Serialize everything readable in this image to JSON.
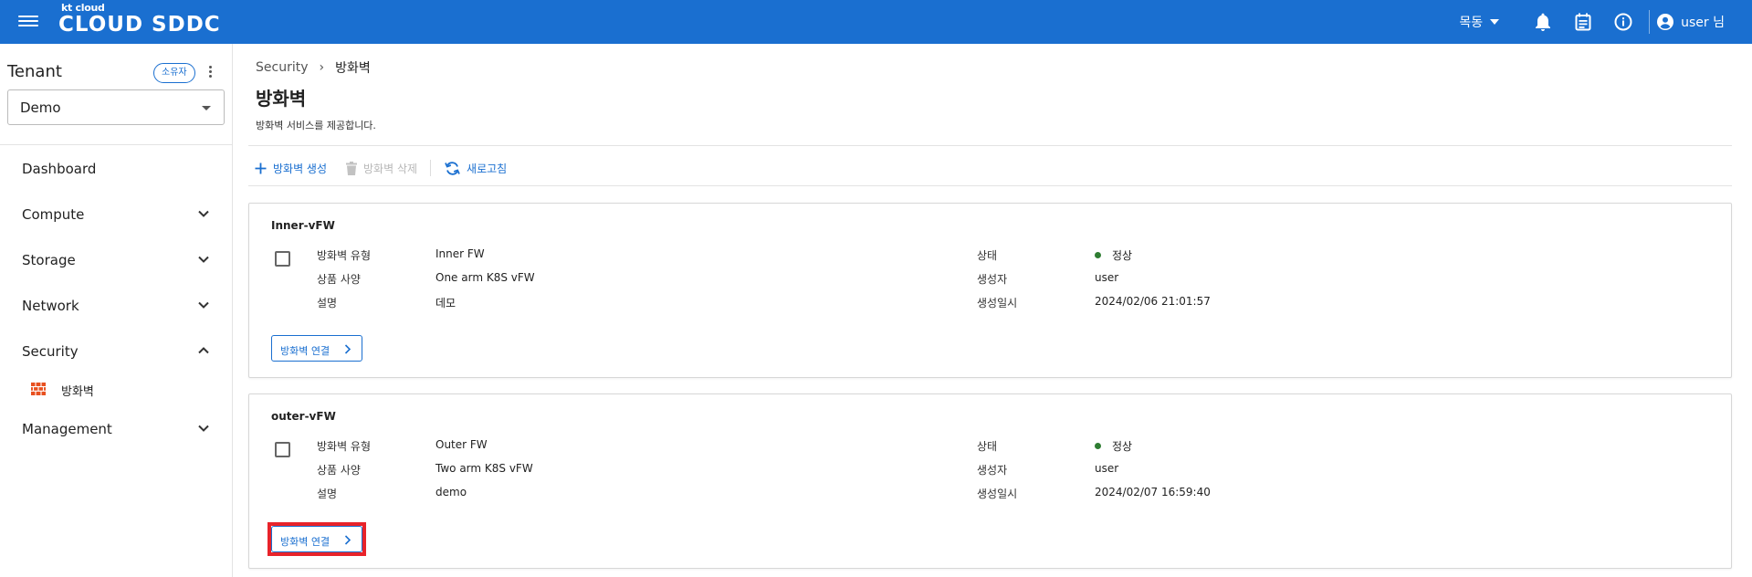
{
  "header": {
    "logo_small": "kt cloud",
    "logo_brand": "CLOUD SDDC",
    "region": "목동",
    "user": "user 님",
    "colors": {
      "bar": "#1a6fd0",
      "text": "#ffffff"
    }
  },
  "sidebar": {
    "tenant_label": "Tenant",
    "owner_badge": "소유자",
    "tenant_value": "Demo",
    "items": [
      {
        "label": "Dashboard",
        "chevron": "none"
      },
      {
        "label": "Compute",
        "chevron": "down"
      },
      {
        "label": "Storage",
        "chevron": "down"
      },
      {
        "label": "Network",
        "chevron": "down"
      },
      {
        "label": "Security",
        "chevron": "up"
      },
      {
        "label": "Management",
        "chevron": "down"
      }
    ],
    "security_sub": {
      "label": "방화벽",
      "icon": "firewall-icon"
    }
  },
  "main": {
    "breadcrumb": [
      "Security",
      "방화벽"
    ],
    "title": "방화벽",
    "description": "방화벽 서비스를 제공합니다.",
    "toolbar": {
      "create": "방화벽 생성",
      "delete": "방화벽 삭제",
      "refresh": "새로고침"
    },
    "cards": [
      {
        "name": "Inner-vFW",
        "type_label": "방화벽 유형",
        "type_value": "Inner FW",
        "spec_label": "상품 사양",
        "spec_value": "One arm K8S vFW",
        "desc_label": "설명",
        "desc_value": "데모",
        "status_label": "상태",
        "status_value": "정상",
        "creator_label": "생성자",
        "creator_value": "user",
        "created_label": "생성일시",
        "created_value": "2024/02/06 21:01:57",
        "link_label": "방화벽 연결"
      },
      {
        "name": "outer-vFW",
        "type_label": "방화벽 유형",
        "type_value": "Outer FW",
        "spec_label": "상품 사양",
        "spec_value": "Two arm K8S vFW",
        "desc_label": "설명",
        "desc_value": "demo",
        "status_label": "상태",
        "status_value": "정상",
        "creator_label": "생성자",
        "creator_value": "user",
        "created_label": "생성일시",
        "created_value": "2024/02/07 16:59:40",
        "link_label": "방화벽 연결"
      }
    ],
    "colors": {
      "accent": "#1a6fd0",
      "status_ok": "#2e7d32",
      "highlight": "#e8232a"
    }
  }
}
